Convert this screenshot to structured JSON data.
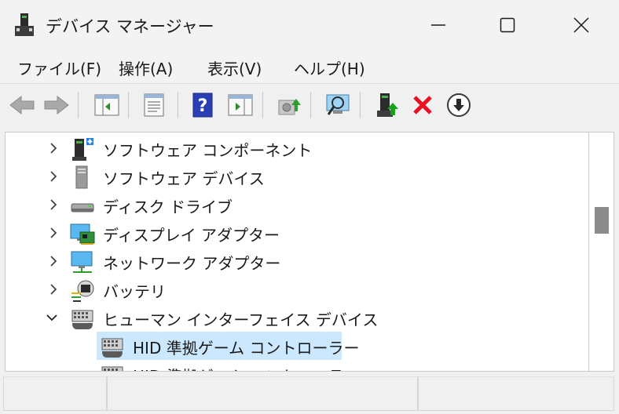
{
  "window": {
    "title": "デバイス マネージャー",
    "icon": "device-manager-icon"
  },
  "titlebar_buttons": {
    "minimize": "minimize-icon",
    "maximize": "maximize-icon",
    "close": "close-icon"
  },
  "menu": {
    "items": [
      {
        "label": "ファイル(F)"
      },
      {
        "label": "操作(A)"
      },
      {
        "label": "表示(V)"
      },
      {
        "label": "ヘルプ(H)"
      }
    ]
  },
  "toolbar": {
    "buttons": [
      {
        "icon": "back-arrow-icon"
      },
      {
        "icon": "forward-arrow-icon"
      },
      {
        "icon": "show-hide-tree-icon"
      },
      {
        "icon": "properties-icon"
      },
      {
        "icon": "help-icon"
      },
      {
        "icon": "action-pane-icon"
      },
      {
        "icon": "update-driver-icon"
      },
      {
        "icon": "scan-hardware-icon"
      },
      {
        "icon": "enable-device-icon"
      },
      {
        "icon": "uninstall-device-icon"
      },
      {
        "icon": "disable-device-icon"
      }
    ]
  },
  "tree": {
    "items": [
      {
        "label": "ソフトウェア コンポーネント",
        "icon": "software-component-icon",
        "expanded": false
      },
      {
        "label": "ソフトウェア デバイス",
        "icon": "software-device-icon",
        "expanded": false
      },
      {
        "label": "ディスク ドライブ",
        "icon": "disk-drive-icon",
        "expanded": false
      },
      {
        "label": "ディスプレイ アダプター",
        "icon": "display-adapter-icon",
        "expanded": false
      },
      {
        "label": "ネットワーク アダプター",
        "icon": "network-adapter-icon",
        "expanded": false
      },
      {
        "label": "バッテリ",
        "icon": "battery-icon",
        "expanded": false
      },
      {
        "label": "ヒューマン インターフェイス デバイス",
        "icon": "hid-icon",
        "expanded": true
      },
      {
        "label": "HID 準拠ゲーム コントローラー",
        "icon": "game-controller-icon",
        "selected": true,
        "child": true
      },
      {
        "label": "HID 準拠ゲーム コントローラー",
        "icon": "game-controller-icon",
        "child": true
      }
    ]
  },
  "colors": {
    "selection": "#cce8ff",
    "scroll_thumb": "#8b8b8b",
    "uninstall_red": "#e81123",
    "enable_green": "#16a31b"
  }
}
